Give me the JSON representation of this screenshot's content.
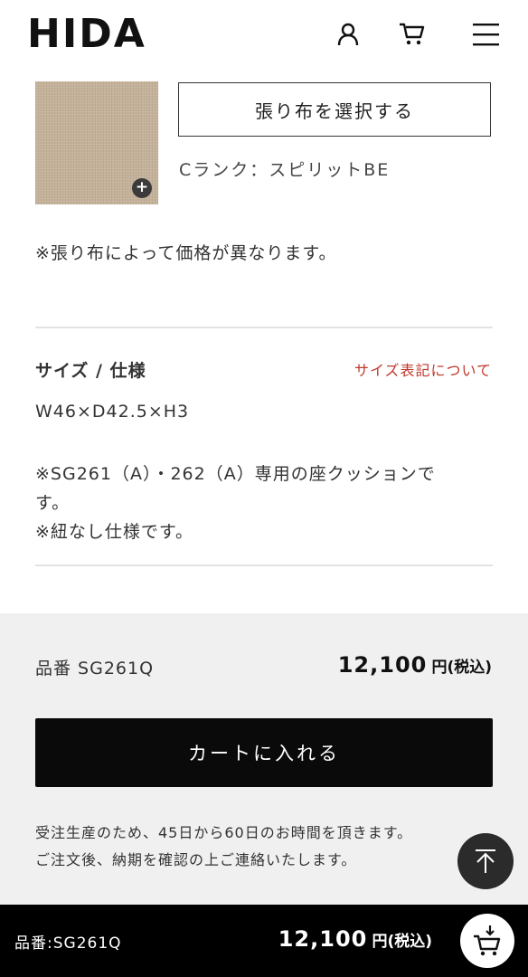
{
  "header": {
    "logo": "HIDA",
    "icons": [
      "user-icon",
      "cart-icon",
      "menu-icon"
    ]
  },
  "fabric": {
    "select_label": "張り布を選択する",
    "selected_name": "Cランク：スピリットBE",
    "swatch_color": "#c4b29a",
    "note": "※張り布によって価格が異なります。"
  },
  "size": {
    "title": "サイズ / 仕様",
    "link_label": "サイズ表記について",
    "dimensions": "W46×D42.5×H3",
    "spec_lines": [
      "※SG261（A）・262（A）専用の座クッションで",
      "す。",
      "※紐なし仕様です。"
    ]
  },
  "purchase": {
    "part_number": "品番 SG261Q",
    "price": "12,100",
    "price_unit": "円(税込)",
    "cart_button_label": "カートに入れる",
    "lead_time_lines": [
      "受注生産のため、45日から60日のお時間を頂きます。",
      "ご注文後、納期を確認の上ご連絡いたします。"
    ]
  },
  "bottom_bar": {
    "part_number": "品番:SG261Q",
    "price": "12,100",
    "price_unit": "円(税込)"
  },
  "colors": {
    "accent_link": "#c0392b",
    "buy_background": "#f0f0f0",
    "cart_button": "#0a0a0a"
  }
}
